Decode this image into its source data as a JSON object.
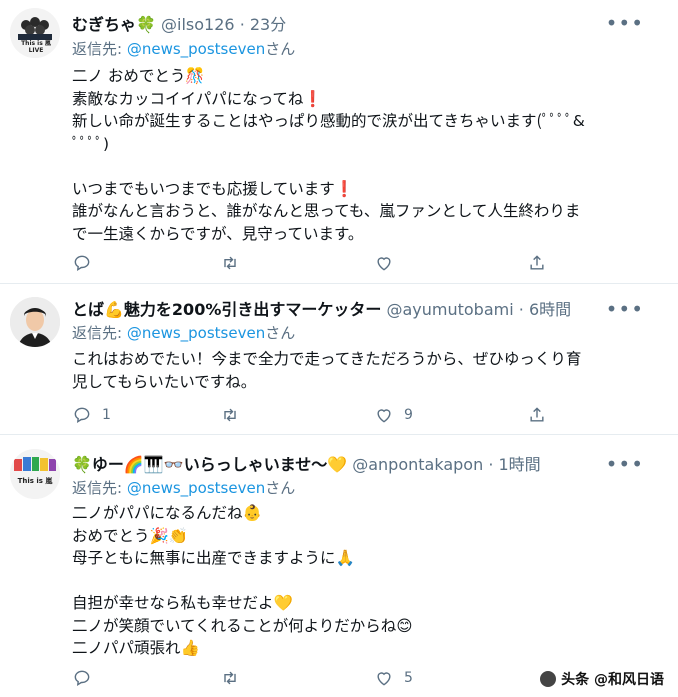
{
  "tweets": [
    {
      "name": "むぎちゃ🍀",
      "handle": "@ilso126",
      "dot": "·",
      "time": "23分",
      "reply_prefix": "返信先: ",
      "reply_to": "@news_postseven",
      "reply_suffix": "さん",
      "lines": [
        "二ノ おめでとう🎊",
        "素敵なカッコイイパパになってね❗",
        "新しい命が誕生することはやっぱり感動的で涙が出てきちゃいます(ﾟﾟﾟﾟ&",
        "ﾟﾟﾟﾟ)",
        "",
        "いつまでもいつまでも応援しています❗",
        "誰がなんと言おうと、誰がなんと思っても、嵐ファンとして人生終わりま",
        "で一生遠くからですが、見守っています。"
      ],
      "counts": {
        "reply": "",
        "retweet": "",
        "like": ""
      }
    },
    {
      "name": "とば💪魅力を200%引き出すマーケッター",
      "handle": "@ayumutobami",
      "dot": "·",
      "time": "6時間",
      "reply_prefix": "返信先: ",
      "reply_to": "@news_postseven",
      "reply_suffix": "さん",
      "lines": [
        "これはおめでたい！今まで全力で走ってきただろうから、ぜひゆっくり育",
        "児してもらいたいですね。"
      ],
      "counts": {
        "reply": "1",
        "retweet": "",
        "like": "9"
      }
    },
    {
      "name": "🍀ゆー🌈🎹👓いらっしゃいませ〜💛",
      "handle": "@anpontakapon",
      "dot": "·",
      "time": "1時間",
      "reply_prefix": "返信先: ",
      "reply_to": "@news_postseven",
      "reply_suffix": "さん",
      "lines": [
        "二ノがパパになるんだね👶",
        "おめでとう🎉👏",
        "母子ともに無事に出産できますように🙏",
        "",
        "自担が幸せなら私も幸せだよ💛",
        "二ノが笑顔でいてくれることが何よりだからね😊",
        "二ノパパ頑張れ👍"
      ],
      "counts": {
        "reply": "",
        "retweet": "",
        "like": "5"
      }
    }
  ],
  "avatar_texts": {
    "t0": "This is 嵐 LIVE",
    "t2": "This is 嵐"
  },
  "watermark": "头条 @和风日语",
  "colors": {
    "text": "#0f1419",
    "muted": "#5b7083",
    "link": "#1b95e0",
    "divider": "#e6ecf0"
  }
}
